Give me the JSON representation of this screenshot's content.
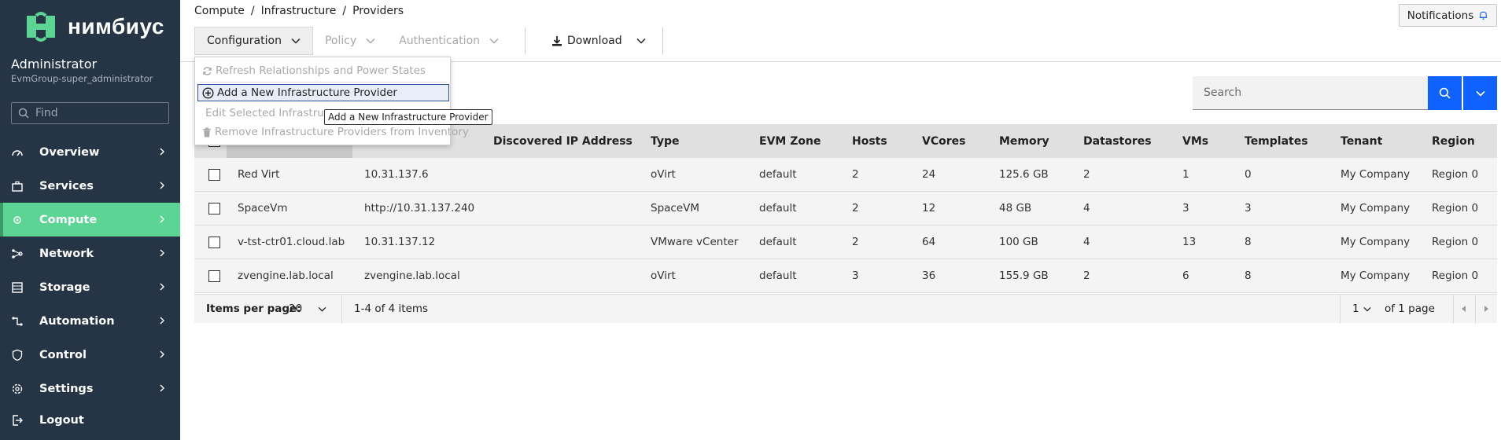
{
  "brand": {
    "name": "нимбиус",
    "accent": "#5bd494",
    "sidebar_bg": "#253545",
    "primary": "#0f62fe"
  },
  "user": {
    "name": "Administrator",
    "group": "EvmGroup-super_administrator"
  },
  "sidebar": {
    "find_placeholder": "Find",
    "items": [
      {
        "label": "Overview",
        "icon": "dashboard-icon"
      },
      {
        "label": "Services",
        "icon": "briefcase-icon"
      },
      {
        "label": "Compute",
        "icon": "gear-chip-icon",
        "active": true
      },
      {
        "label": "Network",
        "icon": "network-icon"
      },
      {
        "label": "Storage",
        "icon": "storage-icon"
      },
      {
        "label": "Automation",
        "icon": "automation-icon"
      },
      {
        "label": "Control",
        "icon": "shield-icon"
      },
      {
        "label": "Settings",
        "icon": "settings-icon"
      }
    ],
    "logout": "Logout"
  },
  "breadcrumb": [
    "Compute",
    "Infrastructure",
    "Providers"
  ],
  "notifications": "Notifications",
  "toolbar": {
    "configuration": "Configuration",
    "policy": "Policy",
    "authentication": "Authentication",
    "download": "Download"
  },
  "menu": {
    "refresh": "Refresh Relationships and Power States",
    "add": "Add a New Infrastructure Provider",
    "edit": "Edit Selected Infrastructure Provider",
    "remove": "Remove Infrastructure Providers from Inventory"
  },
  "tooltip": "Add a New Infrastructure Provider",
  "search": {
    "placeholder": "Search"
  },
  "table": {
    "headers": [
      "Discovered IP Address",
      "Type",
      "EVM Zone",
      "Hosts",
      "VCores",
      "Memory",
      "Datastores",
      "VMs",
      "Templates",
      "Tenant",
      "Region"
    ],
    "rows": [
      [
        "Red Virt",
        "10.31.137.6",
        "oVirt",
        "default",
        "2",
        "24",
        "125.6 GB",
        "2",
        "1",
        "0",
        "My Company",
        "Region 0"
      ],
      [
        "SpaceVm",
        "http://10.31.137.240",
        "SpaceVM",
        "default",
        "2",
        "12",
        "48 GB",
        "4",
        "3",
        "3",
        "My Company",
        "Region 0"
      ],
      [
        "v-tst-ctr01.cloud.lab",
        "10.31.137.12",
        "VMware vCenter",
        "default",
        "2",
        "64",
        "100 GB",
        "4",
        "13",
        "8",
        "My Company",
        "Region 0"
      ],
      [
        "zvengine.lab.local",
        "zvengine.lab.local",
        "oVirt",
        "default",
        "3",
        "36",
        "155.9 GB",
        "2",
        "6",
        "8",
        "My Company",
        "Region 0"
      ]
    ]
  },
  "pagination": {
    "items_per_page_label": "Items per page:",
    "items_per_page": "20",
    "range": "1-4 of 4 items",
    "page": "1",
    "of_pages": "of 1 page"
  }
}
